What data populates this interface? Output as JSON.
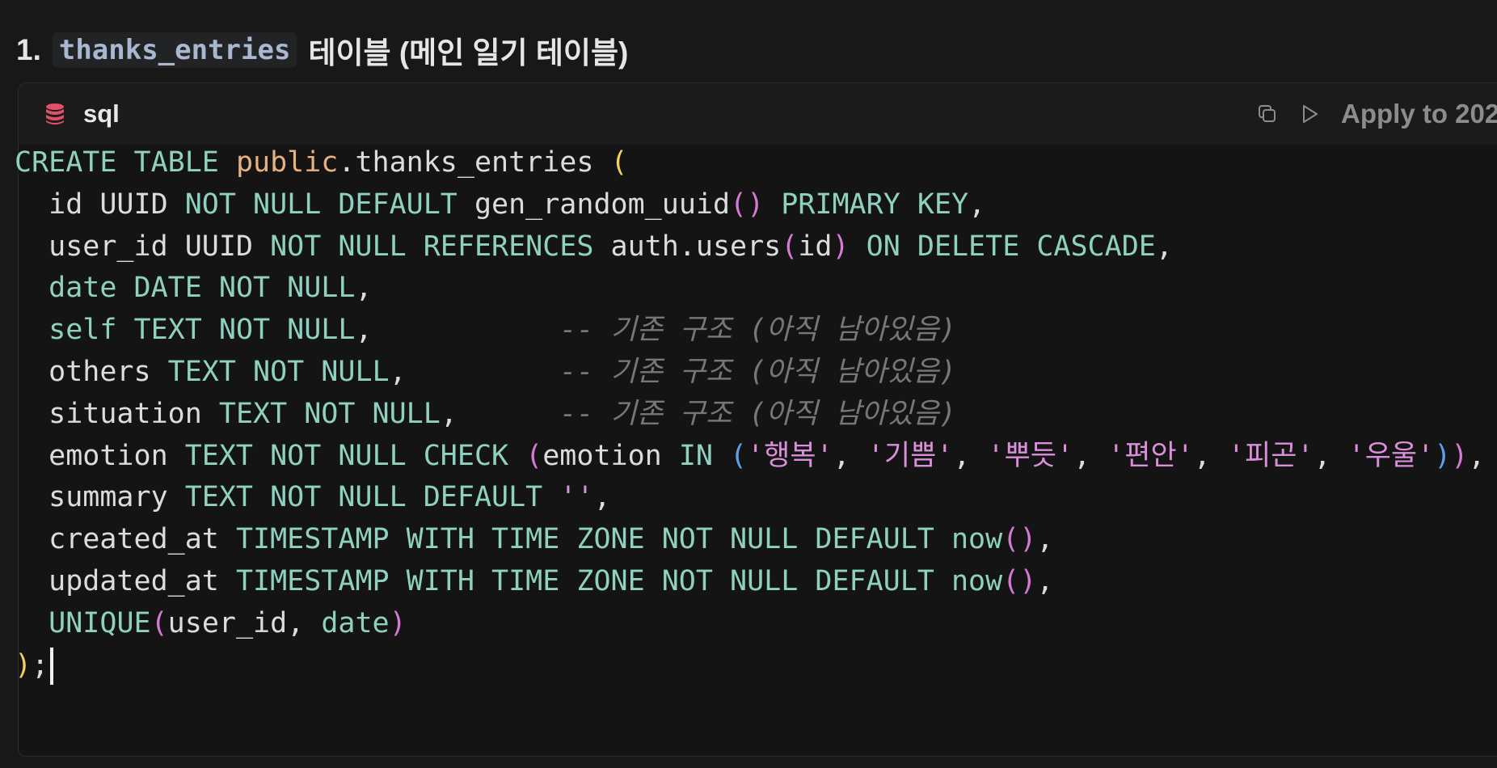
{
  "heading": {
    "number": "1.",
    "table_name": "thanks_entries",
    "suffix": "테이블 (메인 일기 테이블)"
  },
  "code_block": {
    "language": "sql",
    "language_icon": "database-icon",
    "copy_icon": "copy-icon",
    "run_icon": "play-icon",
    "apply_label": "Apply to 202",
    "lines": [
      [
        {
          "t": "CREATE TABLE ",
          "c": "kw"
        },
        {
          "t": "public",
          "c": "pub"
        },
        {
          "t": ".thanks_entries ",
          "c": "plain"
        },
        {
          "t": "(",
          "c": "p1"
        }
      ],
      [
        {
          "t": "  id UUID ",
          "c": "plain"
        },
        {
          "t": "NOT NULL DEFAULT ",
          "c": "kw"
        },
        {
          "t": "gen_random_uuid",
          "c": "plain"
        },
        {
          "t": "()",
          "c": "p2"
        },
        {
          "t": " ",
          "c": "plain"
        },
        {
          "t": "PRIMARY KEY",
          "c": "kw"
        },
        {
          "t": ",",
          "c": "plain"
        }
      ],
      [
        {
          "t": "  user_id UUID ",
          "c": "plain"
        },
        {
          "t": "NOT NULL REFERENCES ",
          "c": "kw"
        },
        {
          "t": "auth.users",
          "c": "plain"
        },
        {
          "t": "(",
          "c": "p2"
        },
        {
          "t": "id",
          "c": "plain"
        },
        {
          "t": ")",
          "c": "p2"
        },
        {
          "t": " ",
          "c": "plain"
        },
        {
          "t": "ON DELETE CASCADE",
          "c": "kw"
        },
        {
          "t": ",",
          "c": "plain"
        }
      ],
      [
        {
          "t": "  ",
          "c": "plain"
        },
        {
          "t": "date DATE NOT NULL",
          "c": "kw"
        },
        {
          "t": ",",
          "c": "plain"
        }
      ],
      [
        {
          "t": "  ",
          "c": "plain"
        },
        {
          "t": "self TEXT NOT NULL",
          "c": "kw"
        },
        {
          "t": ",           ",
          "c": "plain"
        },
        {
          "t": "-- 기존 구조 (아직 남아있음)",
          "c": "cm"
        }
      ],
      [
        {
          "t": "  others ",
          "c": "plain"
        },
        {
          "t": "TEXT NOT NULL",
          "c": "kw"
        },
        {
          "t": ",         ",
          "c": "plain"
        },
        {
          "t": "-- 기존 구조 (아직 남아있음)",
          "c": "cm"
        }
      ],
      [
        {
          "t": "  situation ",
          "c": "plain"
        },
        {
          "t": "TEXT NOT NULL",
          "c": "kw"
        },
        {
          "t": ",      ",
          "c": "plain"
        },
        {
          "t": "-- 기존 구조 (아직 남아있음)",
          "c": "cm"
        }
      ],
      [
        {
          "t": "  emotion ",
          "c": "plain"
        },
        {
          "t": "TEXT NOT NULL CHECK ",
          "c": "kw"
        },
        {
          "t": "(",
          "c": "p2"
        },
        {
          "t": "emotion ",
          "c": "plain"
        },
        {
          "t": "IN ",
          "c": "kw"
        },
        {
          "t": "(",
          "c": "p3"
        },
        {
          "t": "'행복'",
          "c": "str"
        },
        {
          "t": ", ",
          "c": "plain"
        },
        {
          "t": "'기쁨'",
          "c": "str"
        },
        {
          "t": ", ",
          "c": "plain"
        },
        {
          "t": "'뿌듯'",
          "c": "str"
        },
        {
          "t": ", ",
          "c": "plain"
        },
        {
          "t": "'편안'",
          "c": "str"
        },
        {
          "t": ", ",
          "c": "plain"
        },
        {
          "t": "'피곤'",
          "c": "str"
        },
        {
          "t": ", ",
          "c": "plain"
        },
        {
          "t": "'우울'",
          "c": "str"
        },
        {
          "t": ")",
          "c": "p3"
        },
        {
          "t": ")",
          "c": "p2"
        },
        {
          "t": ",",
          "c": "plain"
        }
      ],
      [
        {
          "t": "  summary ",
          "c": "plain"
        },
        {
          "t": "TEXT NOT NULL DEFAULT ",
          "c": "kw"
        },
        {
          "t": "''",
          "c": "str"
        },
        {
          "t": ",",
          "c": "plain"
        }
      ],
      [
        {
          "t": "  created_at ",
          "c": "plain"
        },
        {
          "t": "TIMESTAMP WITH TIME ZONE NOT NULL DEFAULT now",
          "c": "kw"
        },
        {
          "t": "()",
          "c": "p2"
        },
        {
          "t": ",",
          "c": "plain"
        }
      ],
      [
        {
          "t": "  updated_at ",
          "c": "plain"
        },
        {
          "t": "TIMESTAMP WITH TIME ZONE NOT NULL DEFAULT now",
          "c": "kw"
        },
        {
          "t": "()",
          "c": "p2"
        },
        {
          "t": ",",
          "c": "plain"
        }
      ],
      [
        {
          "t": "  ",
          "c": "plain"
        },
        {
          "t": "UNIQUE",
          "c": "kw"
        },
        {
          "t": "(",
          "c": "p2"
        },
        {
          "t": "user_id, ",
          "c": "plain"
        },
        {
          "t": "date",
          "c": "kw"
        },
        {
          "t": ")",
          "c": "p2"
        }
      ],
      [
        {
          "t": ")",
          "c": "p1"
        },
        {
          "t": ";",
          "c": "plain"
        }
      ]
    ]
  },
  "colors": {
    "background": "#181818",
    "keyword": "#8fd1bf",
    "schema": "#e8b17f",
    "string": "#d98fd9",
    "comment": "#777777",
    "language_icon": "#e0506a"
  }
}
